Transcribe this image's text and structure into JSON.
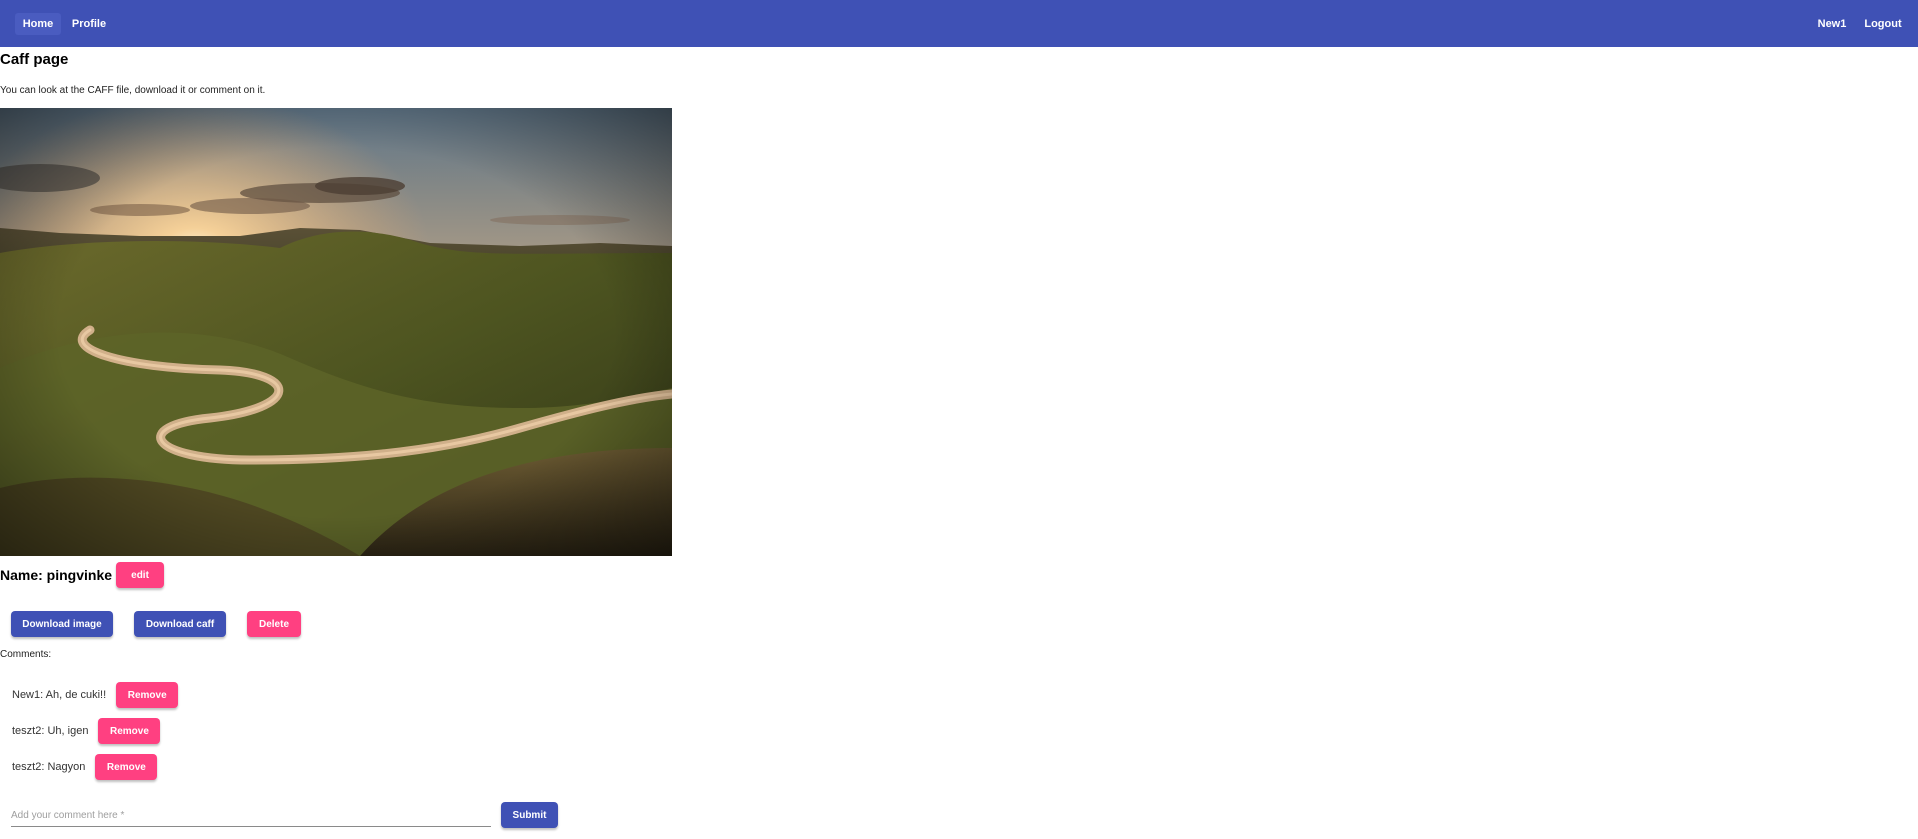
{
  "nav": {
    "home_label": "Home",
    "profile_label": "Profile",
    "user_label": "New1",
    "logout_label": "Logout"
  },
  "page": {
    "title": "Caff page",
    "intro": "You can look at the CAFF file, download it or comment on it."
  },
  "caff": {
    "name_label": "Name: pingvinke",
    "edit_label": "edit",
    "image_subject": "landscape photo of a winding road through hills at sunset"
  },
  "actions": {
    "download_image_label": "Download image",
    "download_caff_label": "Download caff",
    "delete_label": "Delete"
  },
  "comments": {
    "label": "Comments:",
    "items": [
      {
        "text": "New1: Ah, de cuki!!",
        "remove_label": "Remove"
      },
      {
        "text": "teszt2: Uh, igen",
        "remove_label": "Remove"
      },
      {
        "text": "teszt2: Nagyon",
        "remove_label": "Remove"
      }
    ],
    "input_placeholder": "Add your comment here *",
    "input_value": "",
    "submit_label": "Submit"
  },
  "colors": {
    "primary": "#3f51b5",
    "accent": "#ff4081"
  }
}
